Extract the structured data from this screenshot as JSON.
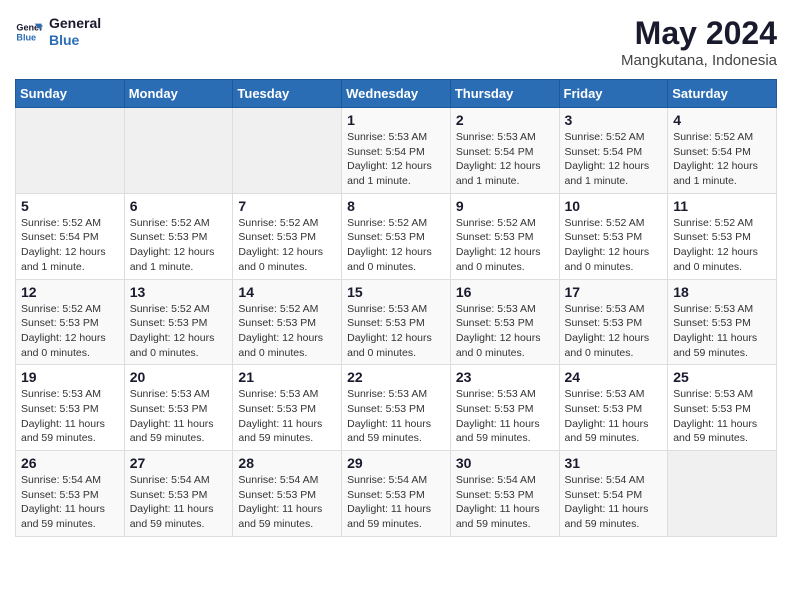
{
  "logo": {
    "line1": "General",
    "line2": "Blue"
  },
  "title": "May 2024",
  "subtitle": "Mangkutana, Indonesia",
  "days_header": [
    "Sunday",
    "Monday",
    "Tuesday",
    "Wednesday",
    "Thursday",
    "Friday",
    "Saturday"
  ],
  "weeks": [
    [
      {
        "num": "",
        "info": ""
      },
      {
        "num": "",
        "info": ""
      },
      {
        "num": "",
        "info": ""
      },
      {
        "num": "1",
        "info": "Sunrise: 5:53 AM\nSunset: 5:54 PM\nDaylight: 12 hours\nand 1 minute."
      },
      {
        "num": "2",
        "info": "Sunrise: 5:53 AM\nSunset: 5:54 PM\nDaylight: 12 hours\nand 1 minute."
      },
      {
        "num": "3",
        "info": "Sunrise: 5:52 AM\nSunset: 5:54 PM\nDaylight: 12 hours\nand 1 minute."
      },
      {
        "num": "4",
        "info": "Sunrise: 5:52 AM\nSunset: 5:54 PM\nDaylight: 12 hours\nand 1 minute."
      }
    ],
    [
      {
        "num": "5",
        "info": "Sunrise: 5:52 AM\nSunset: 5:54 PM\nDaylight: 12 hours\nand 1 minute."
      },
      {
        "num": "6",
        "info": "Sunrise: 5:52 AM\nSunset: 5:53 PM\nDaylight: 12 hours\nand 1 minute."
      },
      {
        "num": "7",
        "info": "Sunrise: 5:52 AM\nSunset: 5:53 PM\nDaylight: 12 hours\nand 0 minutes."
      },
      {
        "num": "8",
        "info": "Sunrise: 5:52 AM\nSunset: 5:53 PM\nDaylight: 12 hours\nand 0 minutes."
      },
      {
        "num": "9",
        "info": "Sunrise: 5:52 AM\nSunset: 5:53 PM\nDaylight: 12 hours\nand 0 minutes."
      },
      {
        "num": "10",
        "info": "Sunrise: 5:52 AM\nSunset: 5:53 PM\nDaylight: 12 hours\nand 0 minutes."
      },
      {
        "num": "11",
        "info": "Sunrise: 5:52 AM\nSunset: 5:53 PM\nDaylight: 12 hours\nand 0 minutes."
      }
    ],
    [
      {
        "num": "12",
        "info": "Sunrise: 5:52 AM\nSunset: 5:53 PM\nDaylight: 12 hours\nand 0 minutes."
      },
      {
        "num": "13",
        "info": "Sunrise: 5:52 AM\nSunset: 5:53 PM\nDaylight: 12 hours\nand 0 minutes."
      },
      {
        "num": "14",
        "info": "Sunrise: 5:52 AM\nSunset: 5:53 PM\nDaylight: 12 hours\nand 0 minutes."
      },
      {
        "num": "15",
        "info": "Sunrise: 5:53 AM\nSunset: 5:53 PM\nDaylight: 12 hours\nand 0 minutes."
      },
      {
        "num": "16",
        "info": "Sunrise: 5:53 AM\nSunset: 5:53 PM\nDaylight: 12 hours\nand 0 minutes."
      },
      {
        "num": "17",
        "info": "Sunrise: 5:53 AM\nSunset: 5:53 PM\nDaylight: 12 hours\nand 0 minutes."
      },
      {
        "num": "18",
        "info": "Sunrise: 5:53 AM\nSunset: 5:53 PM\nDaylight: 11 hours\nand 59 minutes."
      }
    ],
    [
      {
        "num": "19",
        "info": "Sunrise: 5:53 AM\nSunset: 5:53 PM\nDaylight: 11 hours\nand 59 minutes."
      },
      {
        "num": "20",
        "info": "Sunrise: 5:53 AM\nSunset: 5:53 PM\nDaylight: 11 hours\nand 59 minutes."
      },
      {
        "num": "21",
        "info": "Sunrise: 5:53 AM\nSunset: 5:53 PM\nDaylight: 11 hours\nand 59 minutes."
      },
      {
        "num": "22",
        "info": "Sunrise: 5:53 AM\nSunset: 5:53 PM\nDaylight: 11 hours\nand 59 minutes."
      },
      {
        "num": "23",
        "info": "Sunrise: 5:53 AM\nSunset: 5:53 PM\nDaylight: 11 hours\nand 59 minutes."
      },
      {
        "num": "24",
        "info": "Sunrise: 5:53 AM\nSunset: 5:53 PM\nDaylight: 11 hours\nand 59 minutes."
      },
      {
        "num": "25",
        "info": "Sunrise: 5:53 AM\nSunset: 5:53 PM\nDaylight: 11 hours\nand 59 minutes."
      }
    ],
    [
      {
        "num": "26",
        "info": "Sunrise: 5:54 AM\nSunset: 5:53 PM\nDaylight: 11 hours\nand 59 minutes."
      },
      {
        "num": "27",
        "info": "Sunrise: 5:54 AM\nSunset: 5:53 PM\nDaylight: 11 hours\nand 59 minutes."
      },
      {
        "num": "28",
        "info": "Sunrise: 5:54 AM\nSunset: 5:53 PM\nDaylight: 11 hours\nand 59 minutes."
      },
      {
        "num": "29",
        "info": "Sunrise: 5:54 AM\nSunset: 5:53 PM\nDaylight: 11 hours\nand 59 minutes."
      },
      {
        "num": "30",
        "info": "Sunrise: 5:54 AM\nSunset: 5:53 PM\nDaylight: 11 hours\nand 59 minutes."
      },
      {
        "num": "31",
        "info": "Sunrise: 5:54 AM\nSunset: 5:54 PM\nDaylight: 11 hours\nand 59 minutes."
      },
      {
        "num": "",
        "info": ""
      }
    ]
  ]
}
